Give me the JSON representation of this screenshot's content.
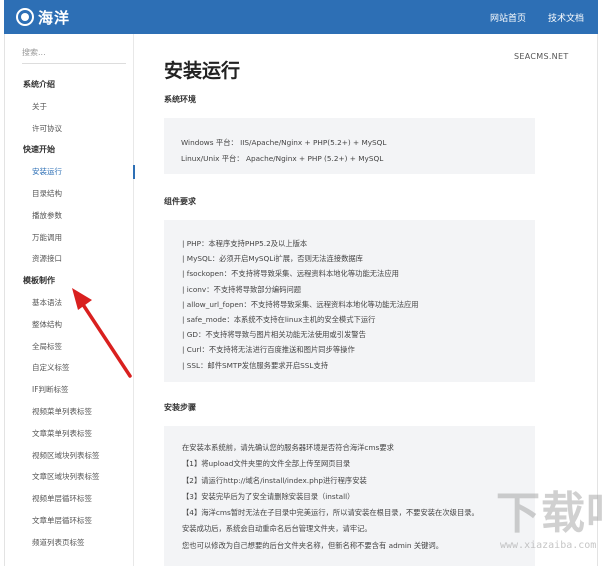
{
  "header": {
    "logo_text": "海洋",
    "nav": [
      "网站首页",
      "技术文档"
    ]
  },
  "search": {
    "placeholder": "搜索..."
  },
  "sidebar": {
    "items": [
      {
        "label": "系统介绍",
        "type": "head"
      },
      {
        "label": "关于",
        "type": "item"
      },
      {
        "label": "许可协议",
        "type": "item"
      },
      {
        "label": "快速开始",
        "type": "head"
      },
      {
        "label": "安装运行",
        "type": "item",
        "active": true
      },
      {
        "label": "目录结构",
        "type": "item"
      },
      {
        "label": "播放参数",
        "type": "item"
      },
      {
        "label": "万能调用",
        "type": "item"
      },
      {
        "label": "资源接口",
        "type": "item"
      },
      {
        "label": "模板制作",
        "type": "head"
      },
      {
        "label": "基本语法",
        "type": "item"
      },
      {
        "label": "整体结构",
        "type": "item"
      },
      {
        "label": "全局标签",
        "type": "item"
      },
      {
        "label": "自定义标签",
        "type": "item"
      },
      {
        "label": "IF判断标签",
        "type": "item"
      },
      {
        "label": "视频菜单列表标签",
        "type": "item"
      },
      {
        "label": "文章菜单列表标签",
        "type": "item"
      },
      {
        "label": "视频区域块列表标签",
        "type": "item"
      },
      {
        "label": "文章区域块列表标签",
        "type": "item"
      },
      {
        "label": "视频单层循环标签",
        "type": "item"
      },
      {
        "label": "文章单层循环标签",
        "type": "item"
      },
      {
        "label": "频道列表页标签",
        "type": "item"
      }
    ]
  },
  "main": {
    "site_tag": "SEACMS.NET",
    "title": "安装运行",
    "env_title": "系统环境",
    "env_lines": [
      "Windows 平台： IIS/Apache/Nginx + PHP(5.2+) + MySQL",
      "Linux/Unix 平台： Apache/Nginx + PHP (5.2+) + MySQL"
    ],
    "comp_title": "组件要求",
    "comp_lines": [
      "| PHP：本程序支持PHP5.2及以上版本",
      "| MySQL：必须开启MySQLi扩展，否则无法连接数据库",
      "| fsockopen：不支持将导致采集、远程资料本地化等功能无法应用",
      "| iconv：不支持将导致部分编码问题",
      "| allow_url_fopen：不支持将导致采集、远程资料本地化等功能无法应用",
      "| safe_mode：本系统不支持在linux主机的安全模式下运行",
      "| GD：不支持将导致与图片相关功能无法使用或引发警告",
      "| Curl：不支持将无法进行百度推送和图片同步等操作",
      "| SSL：邮件SMTP发信服务要求开启SSL支持"
    ],
    "steps_title": "安装步骤",
    "step_lines": [
      "在安装本系统前，请先确认您的服务器环境是否符合海洋cms要求",
      "【1】将upload文件夹里的文件全部上传至网页目录",
      "【2】请运行http://域名/install/index.php进行程序安装",
      "【3】安装完毕后为了安全请删除安装目录（install）",
      "【4】海洋cms暂时无法在子目录中完美运行，所以请安装在根目录，不要安装在次级目录。",
      "安装成功后，系统会自动重命名后台管理文件夹，请牢记。",
      "您也可以修改为自己想要的后台文件夹名称，但新名称不要含有 admin 关键词。"
    ]
  },
  "watermark": {
    "text": "下载吧",
    "url": "www.xiazaiba.com"
  },
  "colors": {
    "header_bg": "#2d6fb5",
    "accent": "#2d6fb5",
    "arrow": "#d9201f",
    "code_bg": "#f3f4f6"
  }
}
